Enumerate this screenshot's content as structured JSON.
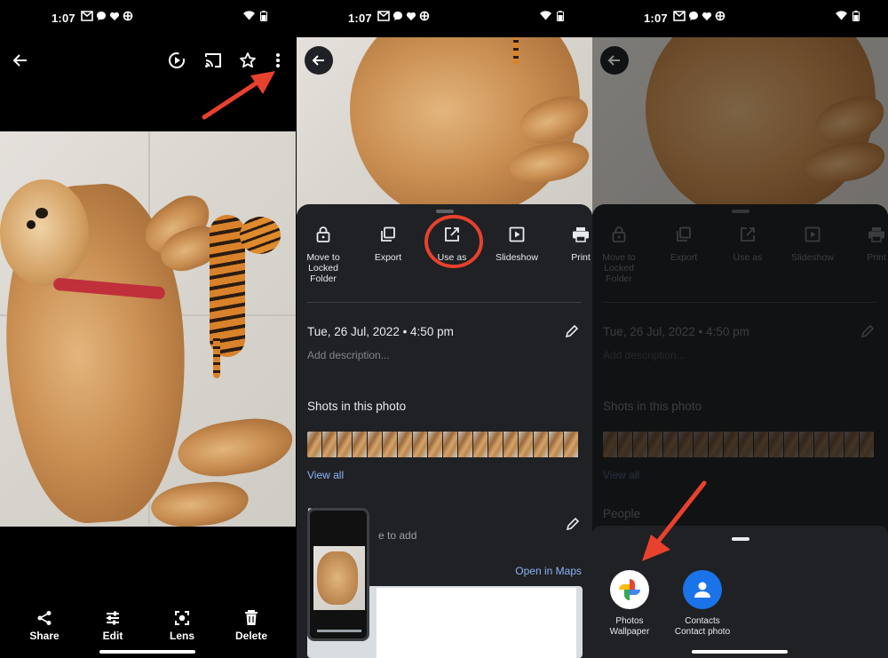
{
  "status": {
    "time": "1:07"
  },
  "viewer": {
    "bottom_actions": [
      {
        "label": "Share",
        "icon": "share-icon"
      },
      {
        "label": "Edit",
        "icon": "sliders-icon"
      },
      {
        "label": "Lens",
        "icon": "lens-icon"
      },
      {
        "label": "Delete",
        "icon": "trash-icon"
      }
    ]
  },
  "info_sheet": {
    "actions": [
      {
        "label": "Move to Locked Folder",
        "icon": "lock-icon"
      },
      {
        "label": "Export",
        "icon": "copy-icon"
      },
      {
        "label": "Use as",
        "icon": "open-external-icon"
      },
      {
        "label": "Slideshow",
        "icon": "slideshow-icon"
      },
      {
        "label": "Print",
        "icon": "printer-icon"
      }
    ],
    "datetime": "Tue, 26 Jul, 2022 • 4:50 pm",
    "description_placeholder": "Add description...",
    "shots_title": "Shots in this photo",
    "view_all": "View all",
    "people_title": "People",
    "people_partial": "e to add",
    "people_initial": "P",
    "open_in_maps": "Open in Maps"
  },
  "chooser": {
    "apps": [
      {
        "name": "Photos",
        "sub": "Wallpaper",
        "icon": "google-photos-icon"
      },
      {
        "name": "Contacts",
        "sub": "Contact photo",
        "icon": "contacts-icon"
      }
    ]
  },
  "colors": {
    "accent_blue": "#8ab4f8",
    "arrow_red": "#e8412e",
    "sheet_bg": "#202124",
    "contacts_blue": "#1a73e8"
  }
}
